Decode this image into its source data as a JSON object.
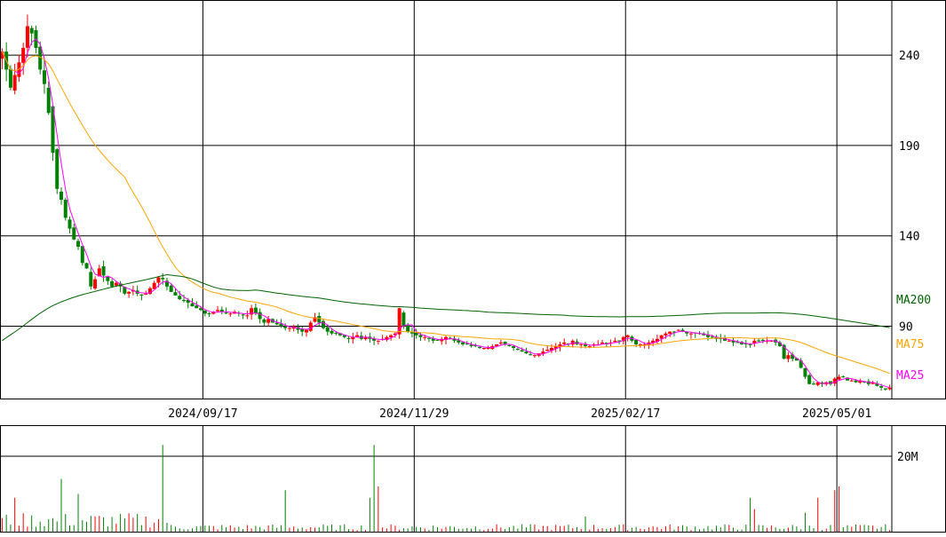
{
  "chart_data": [
    {
      "type": "candlestick",
      "panel": "price",
      "y_ticks": [
        "240",
        "190",
        "140",
        "90"
      ],
      "y_tick_values": [
        240,
        190,
        140,
        90
      ],
      "ylim": [
        50,
        270
      ],
      "x_tick_labels": [
        "2024/09/17",
        "2024/11/29",
        "2025/02/17",
        "2025/05/01"
      ],
      "x_tick_index": [
        48,
        98,
        148,
        198
      ],
      "grid": true,
      "legend": [
        "MA200",
        "MA75",
        "MA25"
      ],
      "colors": {
        "up": "#ff0000",
        "down": "#008000",
        "MA25": "#ff00ff",
        "MA75": "#ffa500",
        "MA200": "#006400",
        "axis": "#000000",
        "grid": "#000000"
      },
      "close": [
        242,
        232,
        222,
        229,
        236,
        244,
        256,
        252,
        244,
        232,
        224,
        208,
        186,
        166,
        160,
        150,
        144,
        138,
        134,
        125,
        122,
        112,
        116,
        122,
        118,
        115,
        112,
        114,
        112,
        108,
        109,
        110,
        108,
        107,
        108,
        111,
        114,
        117,
        116,
        112,
        109,
        107,
        105,
        104,
        103,
        101,
        100,
        99,
        97,
        97,
        98,
        99,
        98,
        97,
        97,
        98,
        97,
        96,
        96,
        100,
        97,
        94,
        92,
        94,
        92,
        91,
        90,
        89,
        89,
        90,
        88,
        87,
        88,
        92,
        95,
        92,
        89,
        87,
        86,
        86,
        85,
        84,
        83,
        84,
        85,
        83,
        84,
        83,
        82,
        82,
        83,
        84,
        85,
        86,
        100,
        90,
        87,
        86,
        85,
        84,
        84,
        83,
        82,
        82,
        83,
        84,
        83,
        82,
        81,
        80,
        80,
        79,
        79,
        78,
        78,
        78,
        79,
        80,
        81,
        80,
        79,
        78,
        77,
        76,
        75,
        74,
        74,
        75,
        76,
        77,
        78,
        79,
        80,
        81,
        80,
        82,
        80,
        80,
        79,
        79,
        80,
        80,
        81,
        80,
        81,
        82,
        82,
        84,
        85,
        82,
        80,
        80,
        80,
        81,
        82,
        83,
        85,
        86,
        87,
        87,
        88,
        87,
        86,
        86,
        86,
        86,
        85,
        84,
        84,
        83,
        83,
        82,
        82,
        81,
        81,
        80,
        80,
        80,
        82,
        82,
        82,
        82,
        82,
        81,
        79,
        72,
        74,
        72,
        71,
        67,
        62,
        58,
        58,
        59,
        58,
        59,
        58,
        61,
        62,
        62,
        60,
        60,
        59,
        60,
        59,
        58,
        59,
        57,
        56,
        55,
        56
      ]
    },
    {
      "type": "bar",
      "panel": "volume",
      "y_ticks": [
        "20M"
      ],
      "y_tick_values": [
        20
      ],
      "ylim": [
        0,
        28
      ]
    }
  ]
}
